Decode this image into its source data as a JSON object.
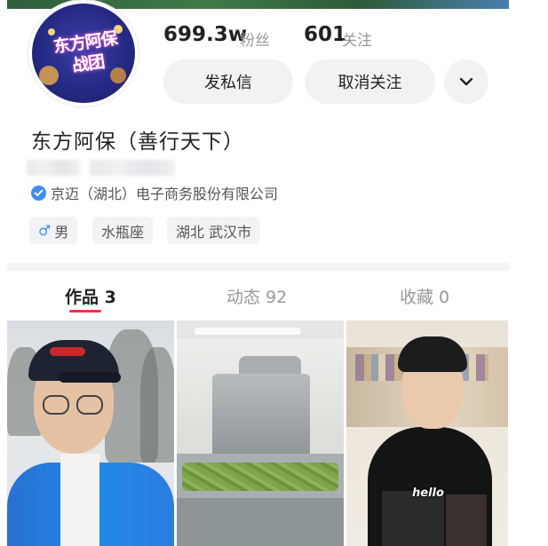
{
  "profile": {
    "avatar_logo_text": "东方阿保战团",
    "followers": {
      "value": "699.3w",
      "label": "粉丝"
    },
    "following": {
      "value": "601",
      "label": "关注"
    },
    "buttons": {
      "message": "发私信",
      "unfollow": "取消关注"
    },
    "name": "东方阿保（善行天下）",
    "verification": "京迈（湖北）电子商务股份有限公司",
    "tags": [
      {
        "icon": "male-icon",
        "label": "男"
      },
      {
        "label": "水瓶座"
      },
      {
        "label": "湖北 武汉市"
      }
    ]
  },
  "tabs": [
    {
      "label": "作品 3",
      "active": true
    },
    {
      "label": "动态 92",
      "active": false
    },
    {
      "label": "收藏 0",
      "active": false
    }
  ],
  "grid": {
    "items": [
      {
        "overlay_text": ""
      },
      {
        "overlay_text": ""
      },
      {
        "overlay_text": "hello"
      }
    ]
  },
  "colors": {
    "accent": "#fe2c55",
    "verify_blue": "#3d8ef0",
    "button_bg": "#f2f2f4"
  }
}
